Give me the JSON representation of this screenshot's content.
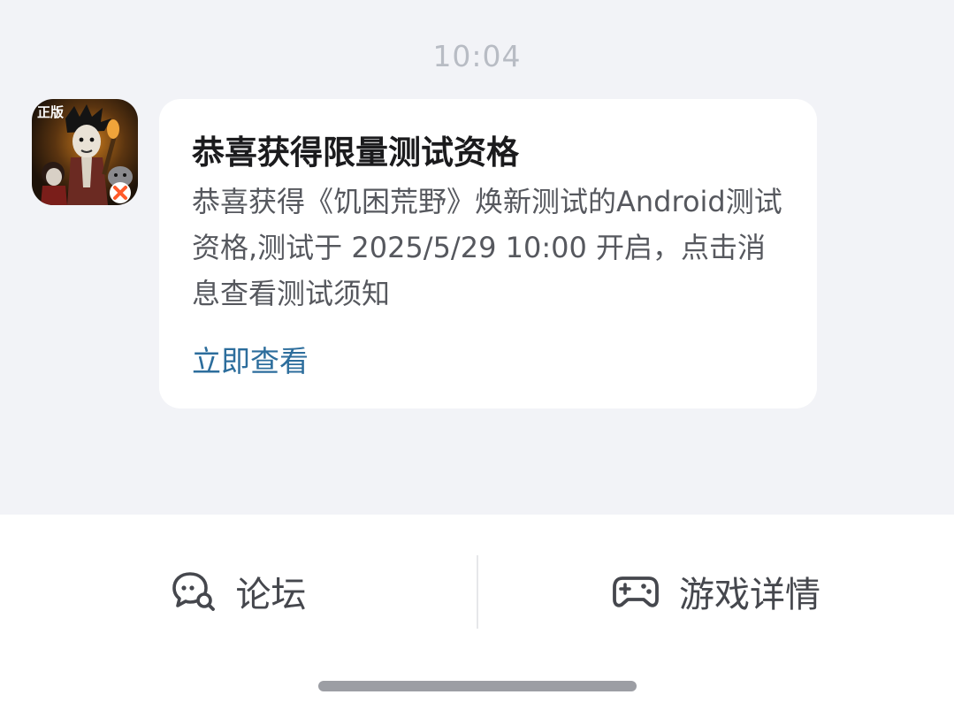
{
  "chat": {
    "timestamp": "10:04",
    "message": {
      "avatar": {
        "icon": "dont-starve-app-icon",
        "badge_text": "正版"
      },
      "title": "恭喜获得限量测试资格",
      "body": "恭喜获得《饥困荒野》焕新测试的Android测试资格,测试于 2025/5/29 10:00 开启，点击消息查看测试须知",
      "link_label": "立即查看"
    }
  },
  "bottom_bar": {
    "tabs": [
      {
        "label": "论坛",
        "icon": "forum-chat-icon"
      },
      {
        "label": "游戏详情",
        "icon": "gamepad-icon"
      }
    ]
  },
  "colors": {
    "background": "#f2f3f7",
    "link": "#2c6d9c",
    "title_text": "#1b1b1d",
    "body_text": "#56585e"
  }
}
